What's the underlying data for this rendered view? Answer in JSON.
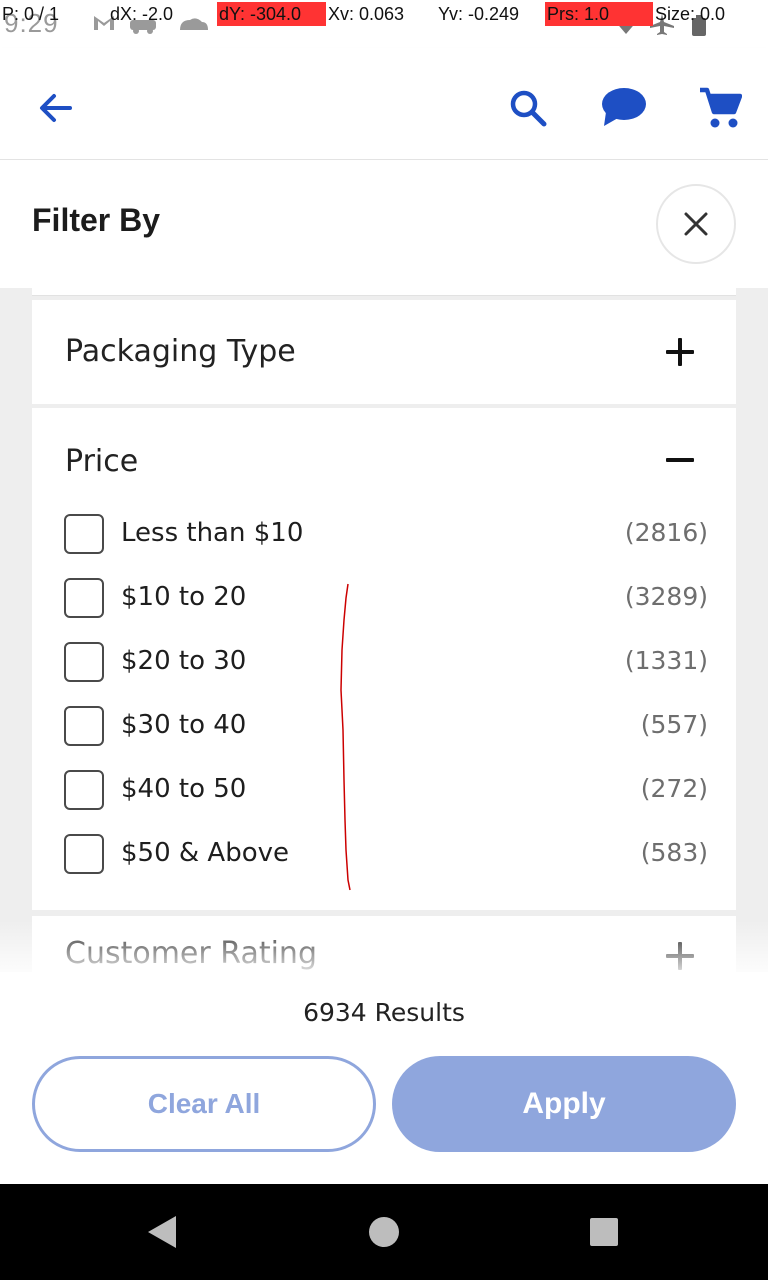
{
  "status_bar": {
    "time": "9:29",
    "debug": {
      "pointer": "P: 0 / 1",
      "dx": "dX: -2.0",
      "dy": "dY: -304.0",
      "xv": "Xv: 0.063",
      "yv": "Yv: -0.249",
      "prs": "Prs: 1.0",
      "size": "Size: 0.0"
    }
  },
  "app_bar": {
    "icons": [
      "back-arrow-icon",
      "search-icon",
      "chat-icon",
      "cart-icon"
    ],
    "accent_color": "#1e4fc4"
  },
  "filter": {
    "title": "Filter By",
    "sections": {
      "packaging": {
        "label": "Packaging Type",
        "state": "collapsed"
      },
      "price": {
        "label": "Price",
        "state": "expanded",
        "options": [
          {
            "label": "Less than $10",
            "count": "(2816)",
            "checked": false
          },
          {
            "label": "$10 to 20",
            "count": "(3289)",
            "checked": false
          },
          {
            "label": "$20 to 30",
            "count": "(1331)",
            "checked": false
          },
          {
            "label": "$30 to 40",
            "count": "(557)",
            "checked": false
          },
          {
            "label": "$40 to 50",
            "count": "(272)",
            "checked": false
          },
          {
            "label": "$50 & Above",
            "count": "(583)",
            "checked": false
          }
        ]
      },
      "rating": {
        "label": "Customer Rating",
        "state": "collapsed"
      }
    }
  },
  "actions": {
    "results": "6934 Results",
    "clear_label": "Clear All",
    "apply_label": "Apply",
    "button_color": "#8fa6dd"
  }
}
